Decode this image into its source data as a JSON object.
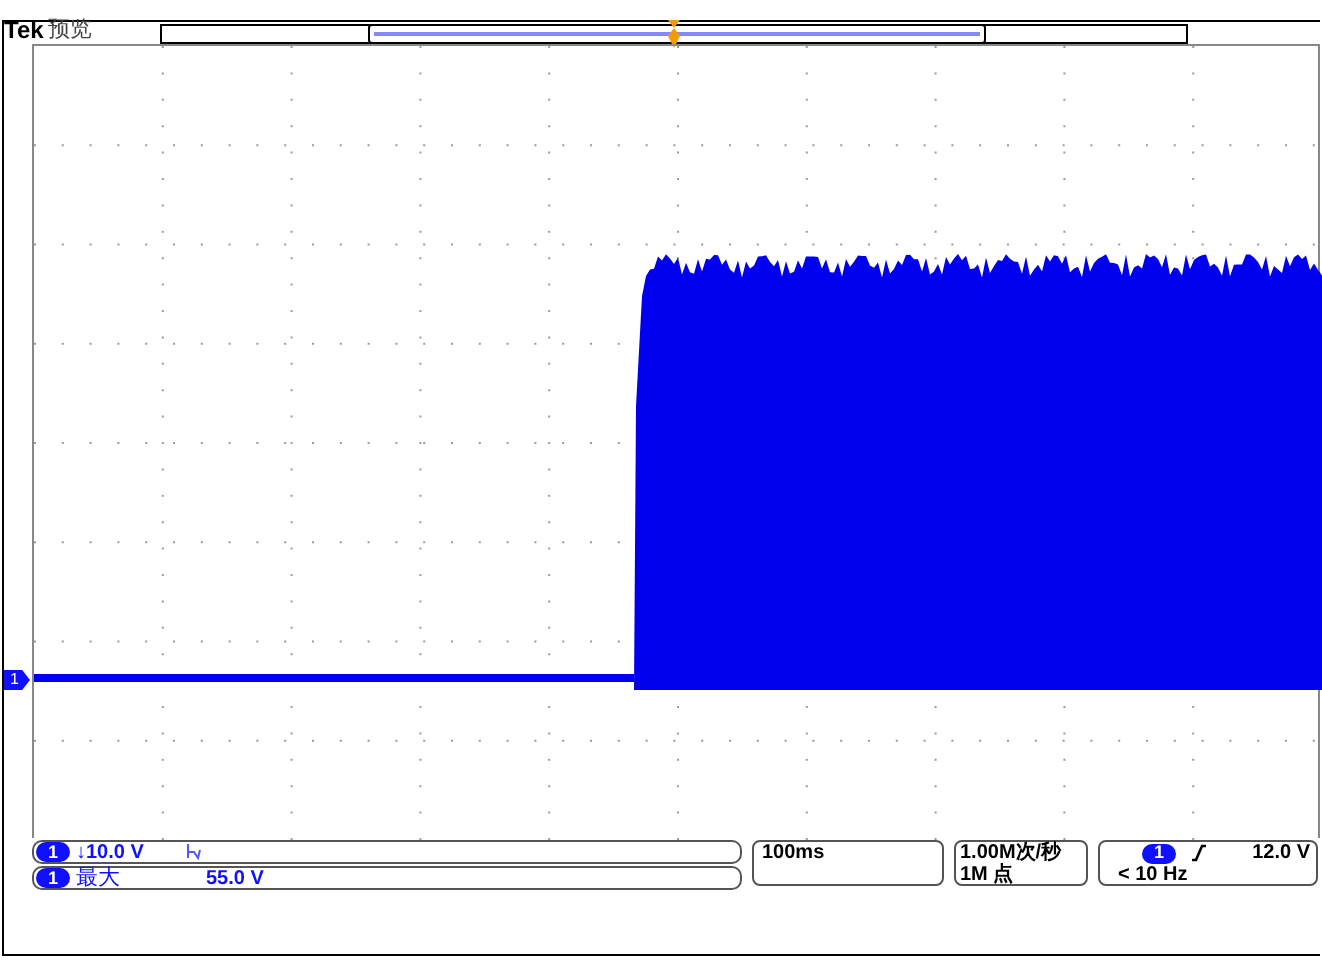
{
  "header": {
    "brand": "Tek",
    "mode": "预览"
  },
  "channel_marker": "1",
  "channel_readout": {
    "channel": "1",
    "scale": "↓10.0 V"
  },
  "measurement": {
    "channel": "1",
    "label": "最大",
    "value": "55.0 V"
  },
  "timebase": "100ms",
  "acquisition": {
    "sample_rate": "1.00M次/秒",
    "record_length": "1M 点"
  },
  "trigger": {
    "channel": "1",
    "level": "12.0 V",
    "frequency": "< 10 Hz"
  }
}
